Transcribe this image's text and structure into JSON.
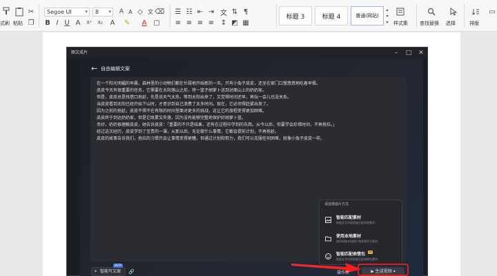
{
  "ribbon": {
    "format_painter_label": "式刷",
    "paste_label": "粘贴",
    "font_name": "Segoe UI",
    "font_size": "8",
    "style_title3": "标题 3",
    "style_title4": "标题 4",
    "style_normal": "普通(网站)",
    "style_set_label": "样式集",
    "find_replace_label": "查找替换",
    "select_label": "选择",
    "sort_label": "排版"
  },
  "dialog": {
    "title": "图文成片",
    "panel_title": "自由编辑文案",
    "ai_button_label": "智能写文案",
    "ai_badge": "BETA",
    "small_btn_label": "操作关",
    "generate_label": "生成视频"
  },
  "story_lines": [
    "在一个阳光明媚的早晨，森林里的小动物们都在忙碌地开始新的一天。只有小兔子皮皮，还坐在家门口慢悠悠地吃着早餐。",
    "皮皮今天有很重要的任务，它需要在太阳落山之前，将一篮子胡萝卜送到对面山上的奶奶家。",
    "但是，皮皮总是找借口拖延，先是说天气太热，等到太阳出来了，又觉得时间还早，再玩一会儿也没关系。",
    "当皮皮看到太阳已经开始下山时，才意识到自己浪费了太多时间。现在，它必须得赶紧出发了。",
    "因为之前的拖延，皮皮不得不在有限的时间里面对更多的挑战，这让它的旅程变得更加困难。",
    "皮皮终于到达奶奶家，但是它既累又失落，因为没有能够完整地保护好胡萝卜篮。",
    "幸好，奶奶很理解皮皮，她告诉皮皮：「重要的不只是结果，还有在过程中学到的东西。从今以后，你要学会珍惜时间，不再拖拉。」",
    "经过这次经历，皮皮学到了宝贵的一课，从那以后，无论做什么事情，它都会提前计划，不再拖延。",
    "皮皮的故事告诉我们，拖拉的习惯只会让事情变得更糟，但通过计划和努力，我们可以克服任何困难，就像小兔子皮皮一样。"
  ],
  "popup": {
    "header": "请选择成片方式",
    "items": [
      {
        "title": "智能匹配素材",
        "desc": "根据文字内容智能匹配网络素材",
        "icon": "image-icon"
      },
      {
        "title": "使用本地素材",
        "desc": "使用电脑本地图片和视频作为素材",
        "icon": "folder-icon"
      },
      {
        "title": "智能匹配表情包",
        "desc": "根据文字内容智能匹配表情包素材",
        "icon": "emoji-icon",
        "badge": "VIP"
      }
    ]
  },
  "colors": {
    "accent_blue": "#3b6ef5",
    "highlight_red": "#e01d1d",
    "dialog_bg": "#1b1d22"
  }
}
